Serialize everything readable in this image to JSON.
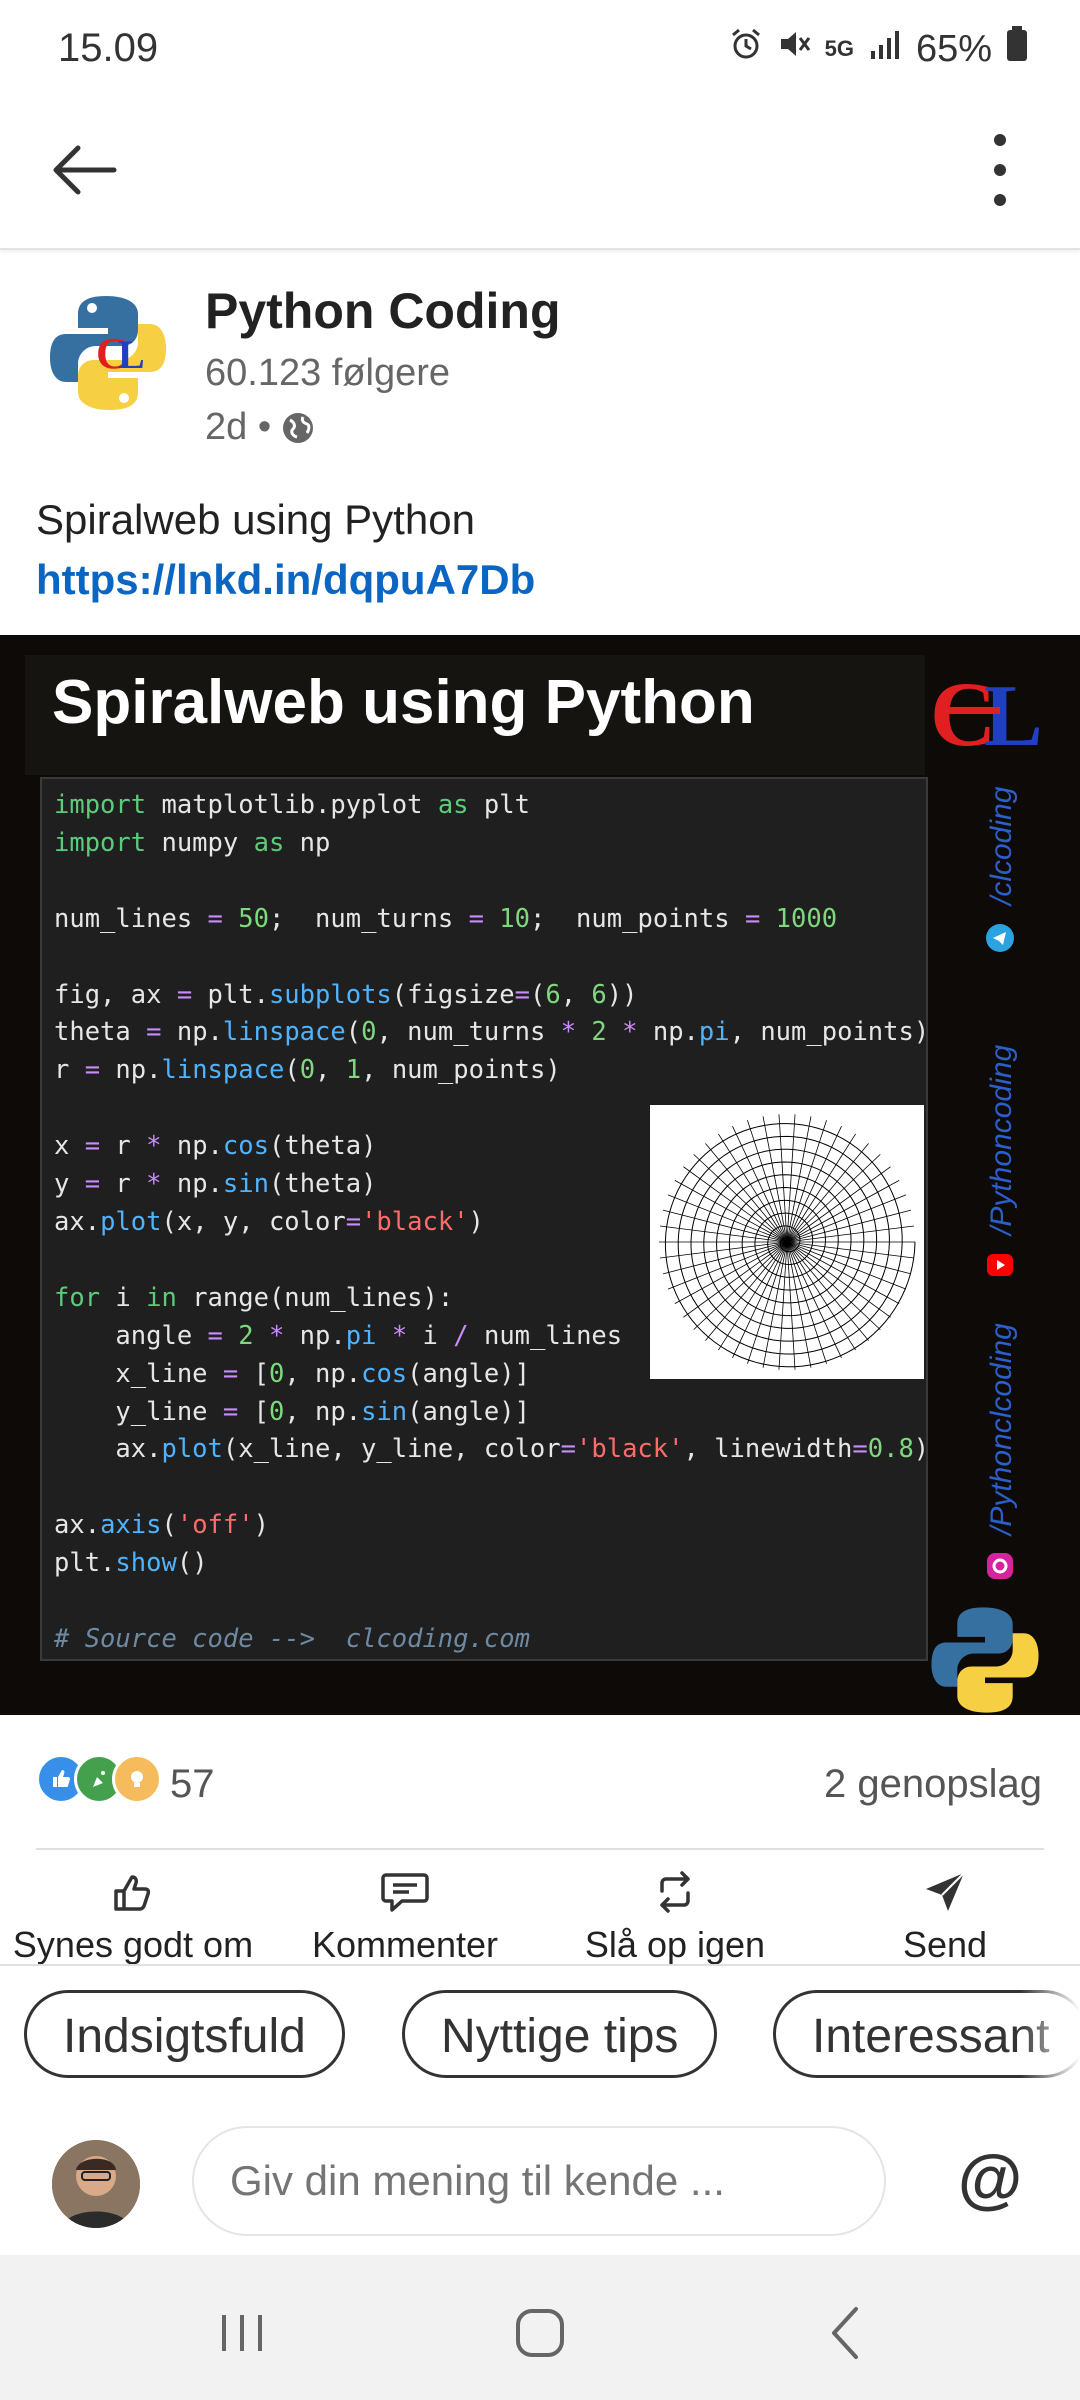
{
  "status": {
    "time": "15.09",
    "network": "5G",
    "battery": "65%"
  },
  "author": {
    "name": "Python Coding",
    "followers": "60.123 følgere",
    "age": "2d •"
  },
  "post": {
    "text": "Spiralweb using Python",
    "link": "https://lnkd.in/dqpuA7Db",
    "image": {
      "title": "Spiralweb using Python",
      "brand": "CL",
      "side_links": [
        "/clcoding",
        "/Pythoncoding",
        "/Pythonclcoding"
      ]
    }
  },
  "engagement": {
    "reactions": "57",
    "reposts": "2 genopslag"
  },
  "actions": {
    "like": "Synes godt om",
    "comment": "Kommenter",
    "repost": "Slå op igen",
    "send": "Send"
  },
  "chips": [
    "Indsigtsfuld",
    "Nyttige tips",
    "Interessant"
  ],
  "comment": {
    "placeholder": "Giv din mening til kende ...",
    "mention": "@"
  },
  "icons": {
    "alarm": "alarm-icon",
    "mute": "mute-icon",
    "signal": "signal-icon",
    "battery": "battery-icon",
    "back": "back-arrow-icon",
    "more": "more-vert-icon",
    "globe": "globe-icon",
    "like": "thumbs-up-icon",
    "comment": "comment-icon",
    "repost": "repost-icon",
    "send": "send-icon"
  }
}
